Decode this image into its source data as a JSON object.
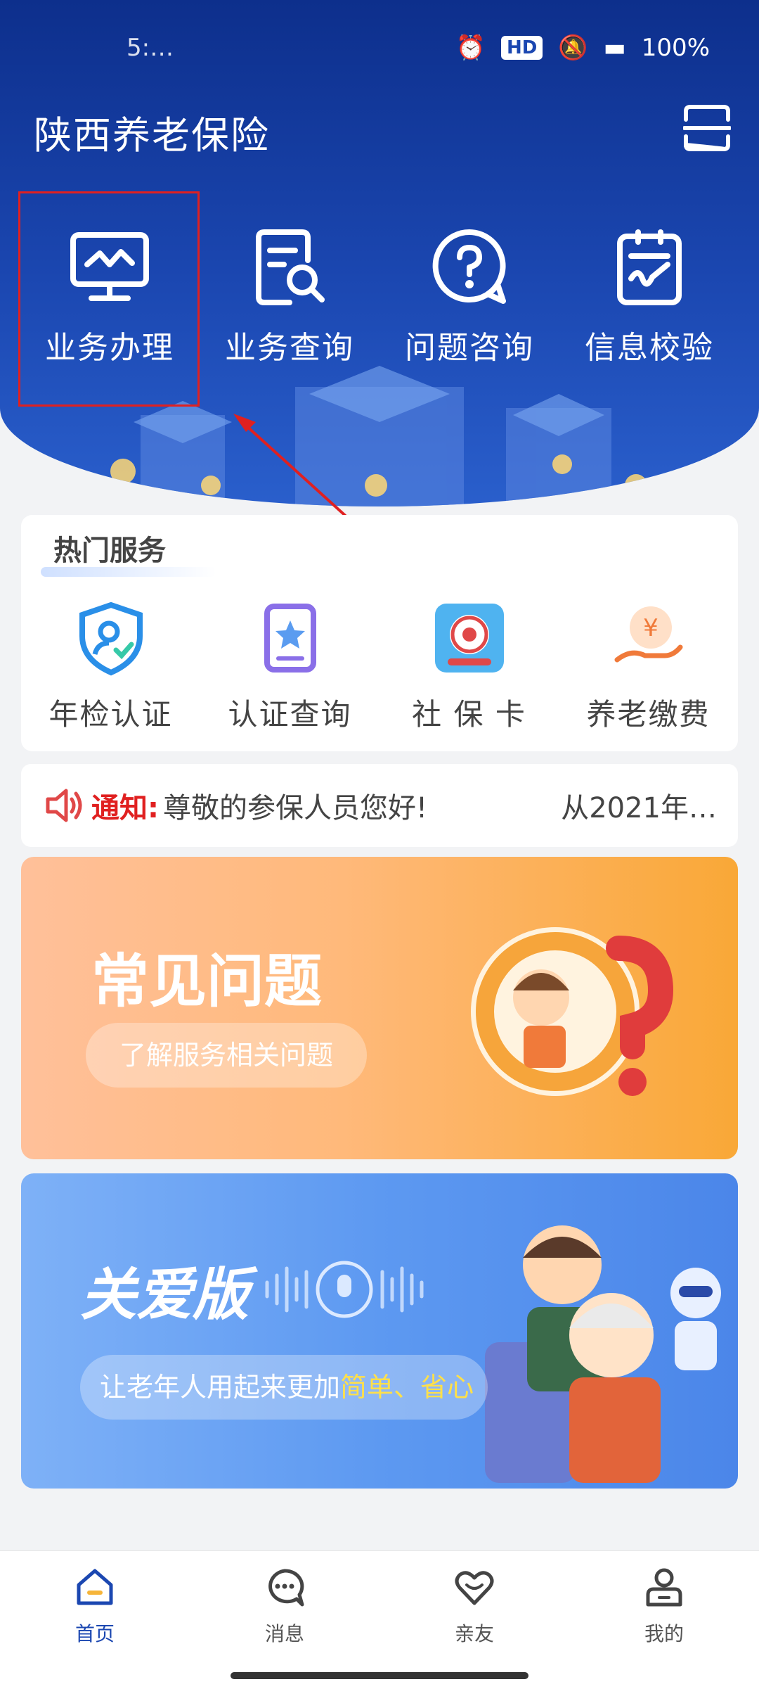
{
  "status_bar": {
    "time": "5:…",
    "hd_badge": "HD",
    "battery": "100%"
  },
  "header": {
    "title": "陕西养老保险",
    "scan_icon": "scan-icon"
  },
  "quick_actions": [
    {
      "label": "业务办理",
      "icon": "monitor-chart-icon",
      "highlighted": true
    },
    {
      "label": "业务查询",
      "icon": "document-search-icon"
    },
    {
      "label": "问题咨询",
      "icon": "question-bubble-icon"
    },
    {
      "label": "信息校验",
      "icon": "document-sign-icon"
    }
  ],
  "hot_services": {
    "title": "热门服务",
    "items": [
      {
        "label": "年检认证",
        "icon": "shield-person-icon"
      },
      {
        "label": "认证查询",
        "icon": "star-card-icon"
      },
      {
        "label": "社 保 卡",
        "icon": "social-security-card-icon"
      },
      {
        "label": "养老缴费",
        "icon": "yuan-hand-icon"
      }
    ]
  },
  "notice": {
    "label": "通知:",
    "message": "尊敬的参保人员您好!",
    "message_tail": "从2021年…"
  },
  "banners": {
    "faq": {
      "title": "常见问题",
      "subtitle": "了解服务相关问题"
    },
    "care": {
      "title": "关爱版",
      "subtitle_prefix": "让老年人用起来更加",
      "subtitle_highlight": "简单、省心"
    }
  },
  "tabbar": {
    "items": [
      {
        "label": "首页",
        "icon": "home-icon",
        "active": true
      },
      {
        "label": "消息",
        "icon": "message-icon"
      },
      {
        "label": "亲友",
        "icon": "heart-icon"
      },
      {
        "label": "我的",
        "icon": "profile-icon"
      }
    ]
  },
  "colors": {
    "primary": "#1b47b1",
    "highlight_red": "#e02020",
    "care_yellow": "#ffe04a"
  }
}
